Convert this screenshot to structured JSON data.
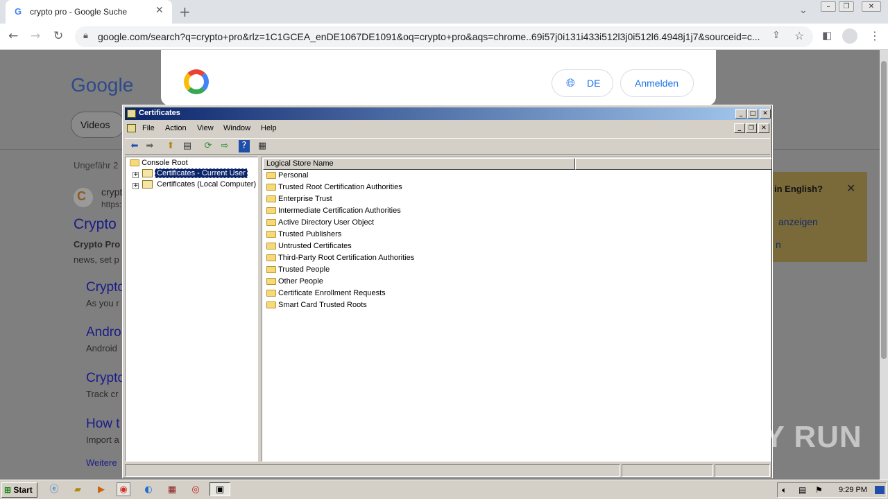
{
  "browser": {
    "tab_title": "crypto pro - Google Suche",
    "tab_icon": "G",
    "new_tab": "+",
    "url": "google.com/search?q=crypto+pro&rlz=1C1GCEA_enDE1067DE1091&oq=crypto+pro&aqs=chrome..69i57j0i131i433i512l3j0i512l6.4948j1j7&sourceid=c..."
  },
  "google_page": {
    "logo": "Google",
    "videos_pill": "Videos",
    "result_count_prefix": "Ungefähr 2",
    "lang_button": "DE",
    "signin_button": "Anmelden",
    "results": [
      {
        "title": "Crypto",
        "snippet": "Crypto Pro",
        "snippet2": "news, set p"
      },
      {
        "title": "Crypto",
        "snippet": "As you r"
      },
      {
        "title": "Andro",
        "snippet": "Android"
      },
      {
        "title": "Crypto",
        "snippet": "Track cr"
      },
      {
        "title": "How t",
        "snippet": "Import a"
      }
    ],
    "site_name": "crypt",
    "site_url": "https:",
    "more": "Weitere",
    "lang_panel": {
      "question": "in English?",
      "link1": "anzeigen",
      "link2": "n"
    }
  },
  "mmc": {
    "title": "Certificates",
    "menu": [
      "File",
      "Action",
      "View",
      "Window",
      "Help"
    ],
    "tree": {
      "root": "Console Root",
      "items": [
        "Certificates - Current User",
        "Certificates (Local Computer)"
      ]
    },
    "column_header": "Logical Store Name",
    "stores": [
      "Personal",
      "Trusted Root Certification Authorities",
      "Enterprise Trust",
      "Intermediate Certification Authorities",
      "Active Directory User Object",
      "Trusted Publishers",
      "Untrusted Certificates",
      "Third-Party Root Certification Authorities",
      "Trusted People",
      "Other People",
      "Certificate Enrollment Requests",
      "Smart Card Trusted Roots"
    ]
  },
  "taskbar": {
    "start": "Start",
    "clock": "9:29 PM"
  },
  "watermark": "ANY RUN"
}
